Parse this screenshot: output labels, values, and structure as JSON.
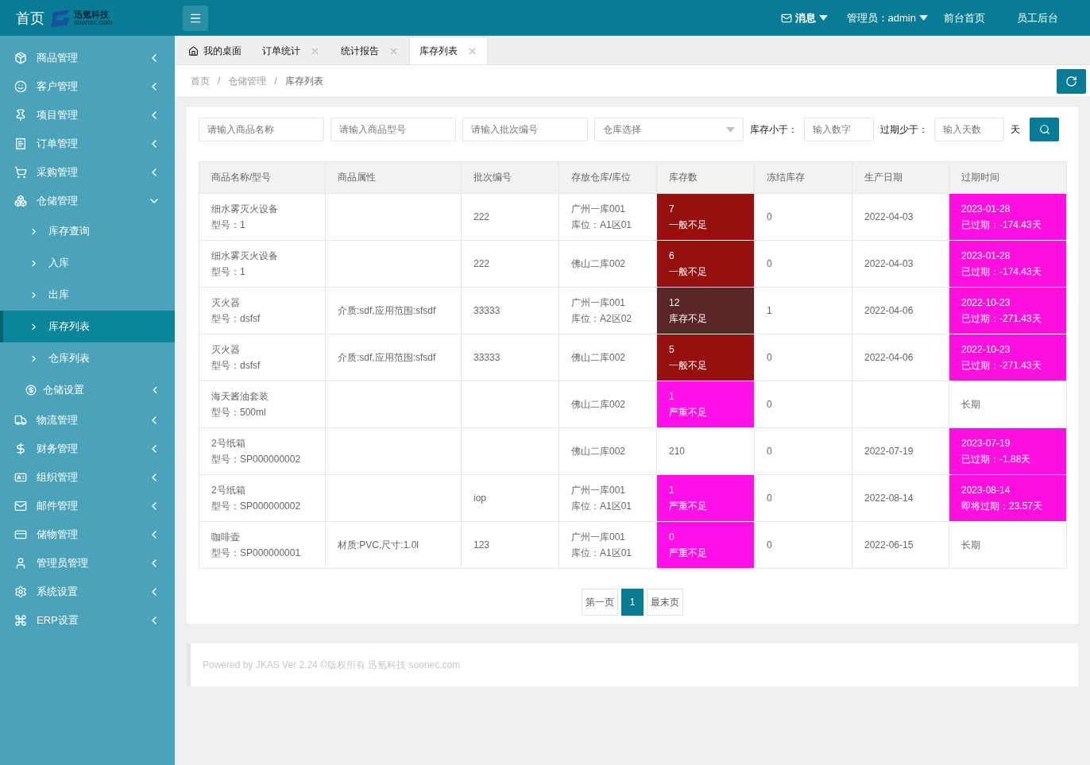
{
  "header": {
    "title": "首页",
    "logo": {
      "name": "迅氪科技",
      "domain": "soonec.com"
    },
    "nav": [
      {
        "label": "消息",
        "kind": "mail"
      },
      {
        "label": "管理员：admin",
        "kind": "dropdown"
      },
      {
        "label": "前台首页",
        "kind": "link"
      },
      {
        "label": "员工后台",
        "kind": "link"
      }
    ]
  },
  "sidebar": {
    "items": [
      {
        "label": "商品管理",
        "expanded": false
      },
      {
        "label": "客户管理",
        "expanded": false
      },
      {
        "label": "项目管理",
        "expanded": false
      },
      {
        "label": "订单管理",
        "expanded": false
      },
      {
        "label": "采购管理",
        "expanded": false
      },
      {
        "label": "仓储管理",
        "expanded": true,
        "children": [
          {
            "label": "库存查询",
            "kind": "link",
            "selected": false
          },
          {
            "label": "入库",
            "kind": "link",
            "selected": false
          },
          {
            "label": "出库",
            "kind": "link",
            "selected": false
          },
          {
            "label": "库存列表",
            "kind": "link",
            "selected": true
          },
          {
            "label": "仓库列表",
            "kind": "link",
            "selected": false
          },
          {
            "label": "仓储设置",
            "kind": "group",
            "selected": false
          }
        ]
      },
      {
        "label": "物流管理",
        "expanded": false
      },
      {
        "label": "财务管理",
        "expanded": false
      },
      {
        "label": "组织管理",
        "expanded": false
      },
      {
        "label": "邮件管理",
        "expanded": false
      },
      {
        "label": "储物管理",
        "expanded": false
      },
      {
        "label": "管理员管理",
        "expanded": false
      },
      {
        "label": "系统设置",
        "expanded": false
      },
      {
        "label": "ERP设置",
        "expanded": false
      }
    ]
  },
  "tabs": [
    {
      "label": "我的桌面",
      "closable": false,
      "selected": false
    },
    {
      "label": "订单统计",
      "closable": true,
      "selected": false
    },
    {
      "label": "统计报告",
      "closable": true,
      "selected": false
    },
    {
      "label": "库存列表",
      "closable": true,
      "selected": true
    }
  ],
  "breadcrumb": {
    "separator": "/",
    "items": [
      "首页",
      "仓储管理",
      "库存列表"
    ]
  },
  "filters": [
    {
      "kind": "text",
      "placeholder": "请输入商品名称"
    },
    {
      "kind": "text",
      "placeholder": "请输入商品型号"
    },
    {
      "kind": "text",
      "placeholder": "请输入批次编号"
    },
    {
      "kind": "select",
      "placeholder": "仓库选择"
    },
    {
      "kind": "label",
      "label": "库存小于："
    },
    {
      "kind": "number",
      "placeholder": "输入数字"
    },
    {
      "kind": "label",
      "label": "过期少于："
    },
    {
      "kind": "number",
      "placeholder": "输入天数"
    },
    {
      "kind": "label",
      "label": "天"
    }
  ],
  "table": {
    "columns": [
      "商品名称/型号",
      "商品属性",
      "批次编号",
      "存放仓库/库位",
      "库存数",
      "冻结库存",
      "生产日期",
      "过期时间"
    ],
    "rows": [
      {
        "name": "细水雾灭火设备",
        "model": "型号：1",
        "attrs": "",
        "batch": "222",
        "location": [
          "广州一库001",
          "库位：A1区01"
        ],
        "stock": {
          "value": "7",
          "status": "一般不足",
          "color": "#961010"
        },
        "frozen": "0",
        "produced": "2022-04-03",
        "expiry": {
          "date": "2023-01-28",
          "note": "已过期：-174.43天",
          "color": "#ff10e0"
        }
      },
      {
        "name": "细水雾灭火设备",
        "model": "型号：1",
        "attrs": "",
        "batch": "222",
        "location": [
          "佛山二库002"
        ],
        "stock": {
          "value": "6",
          "status": "一般不足",
          "color": "#961010"
        },
        "frozen": "0",
        "produced": "2022-04-03",
        "expiry": {
          "date": "2023-01-28",
          "note": "已过期：-174.43天",
          "color": "#ff10e0"
        }
      },
      {
        "name": "灭火器",
        "model": "型号：dsfsf",
        "attrs": "介质:sdf,应用范围:sfsdf",
        "batch": "33333",
        "location": [
          "广州一库001",
          "库位：A2区02"
        ],
        "stock": {
          "value": "12",
          "status": "库存不足",
          "color": "#5a2626"
        },
        "frozen": "1",
        "produced": "2022-04-06",
        "expiry": {
          "date": "2022-10-23",
          "note": "已过期：-271.43天",
          "color": "#ff10e0"
        }
      },
      {
        "name": "灭火器",
        "model": "型号：dsfsf",
        "attrs": "介质:sdf,应用范围:sfsdf",
        "batch": "33333",
        "location": [
          "佛山二库002"
        ],
        "stock": {
          "value": "5",
          "status": "一般不足",
          "color": "#961010"
        },
        "frozen": "0",
        "produced": "2022-04-06",
        "expiry": {
          "date": "2022-10-23",
          "note": "已过期：-271.43天",
          "color": "#ff10e0"
        }
      },
      {
        "name": "海天酱油套装",
        "model": "型号：500ml",
        "attrs": "",
        "batch": "",
        "location": [
          "佛山二库002"
        ],
        "stock": {
          "value": "1",
          "status": "严重不足",
          "color": "#ff10e8"
        },
        "frozen": "0",
        "produced": "",
        "expiry": {
          "date": "长期"
        }
      },
      {
        "name": "2号纸箱",
        "model": "型号：SP000000002",
        "attrs": "",
        "batch": "",
        "location": [
          "佛山二库002"
        ],
        "stock": {
          "value": "210"
        },
        "frozen": "0",
        "produced": "2022-07-19",
        "expiry": {
          "date": "2023-07-19",
          "note": "已过期：-1.88天",
          "color": "#ff10e0"
        }
      },
      {
        "name": "2号纸箱",
        "model": "型号：SP000000002",
        "attrs": "",
        "batch": "iop",
        "location": [
          "广州一库001",
          "库位：A1区01"
        ],
        "stock": {
          "value": "1",
          "status": "严重不足",
          "color": "#ff10e8"
        },
        "frozen": "0",
        "produced": "2022-08-14",
        "expiry": {
          "date": "2023-08-14",
          "note": "即将过期：23.57天",
          "color": "#ff10e0"
        }
      },
      {
        "name": "咖啡壶",
        "model": "型号：SP000000001",
        "attrs": "材质:PVC,尺寸:1.0l",
        "batch": "123",
        "location": [
          "广州一库001",
          "库位：A1区01"
        ],
        "stock": {
          "value": "0",
          "status": "严重不足",
          "color": "#ff10e8"
        },
        "frozen": "0",
        "produced": "2022-06-15",
        "expiry": {
          "date": "长期"
        }
      }
    ]
  },
  "pagination": [
    {
      "label": "第一页",
      "selected": false
    },
    {
      "label": "1",
      "selected": true
    },
    {
      "label": "最末页",
      "selected": false
    }
  ],
  "footer": "Powered by JKAS Ver 2.24 ©版权所有 迅氪科技 soonec.com"
}
